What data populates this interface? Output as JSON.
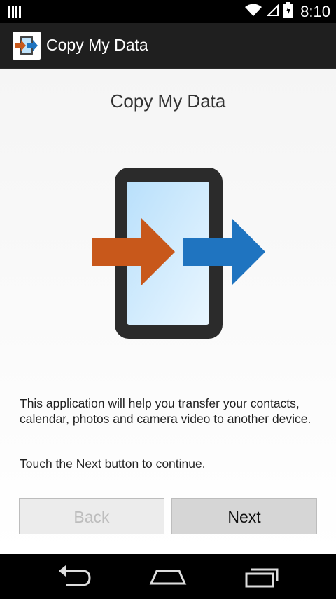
{
  "status_bar": {
    "time": "8:10",
    "icons": [
      "signal-bars-icon",
      "wifi-icon",
      "no-signal-icon",
      "battery-icon"
    ]
  },
  "action_bar": {
    "app_title": "Copy My Data",
    "app_icon": "copy-my-data-logo"
  },
  "main": {
    "title": "Copy My Data",
    "description": "This application will help you transfer your contacts, calendar, photos and camera video to another device.",
    "hint": "Touch the Next button to continue.",
    "buttons": {
      "back": "Back",
      "next": "Next"
    },
    "hero_colors": {
      "orange_arrow": "#c8581b",
      "blue_arrow": "#1f74c0",
      "phone_body": "#2b2b2b",
      "screen": "#bfe3fb"
    }
  },
  "navigation": {
    "icons": [
      "back-icon",
      "home-icon",
      "recents-icon"
    ]
  }
}
